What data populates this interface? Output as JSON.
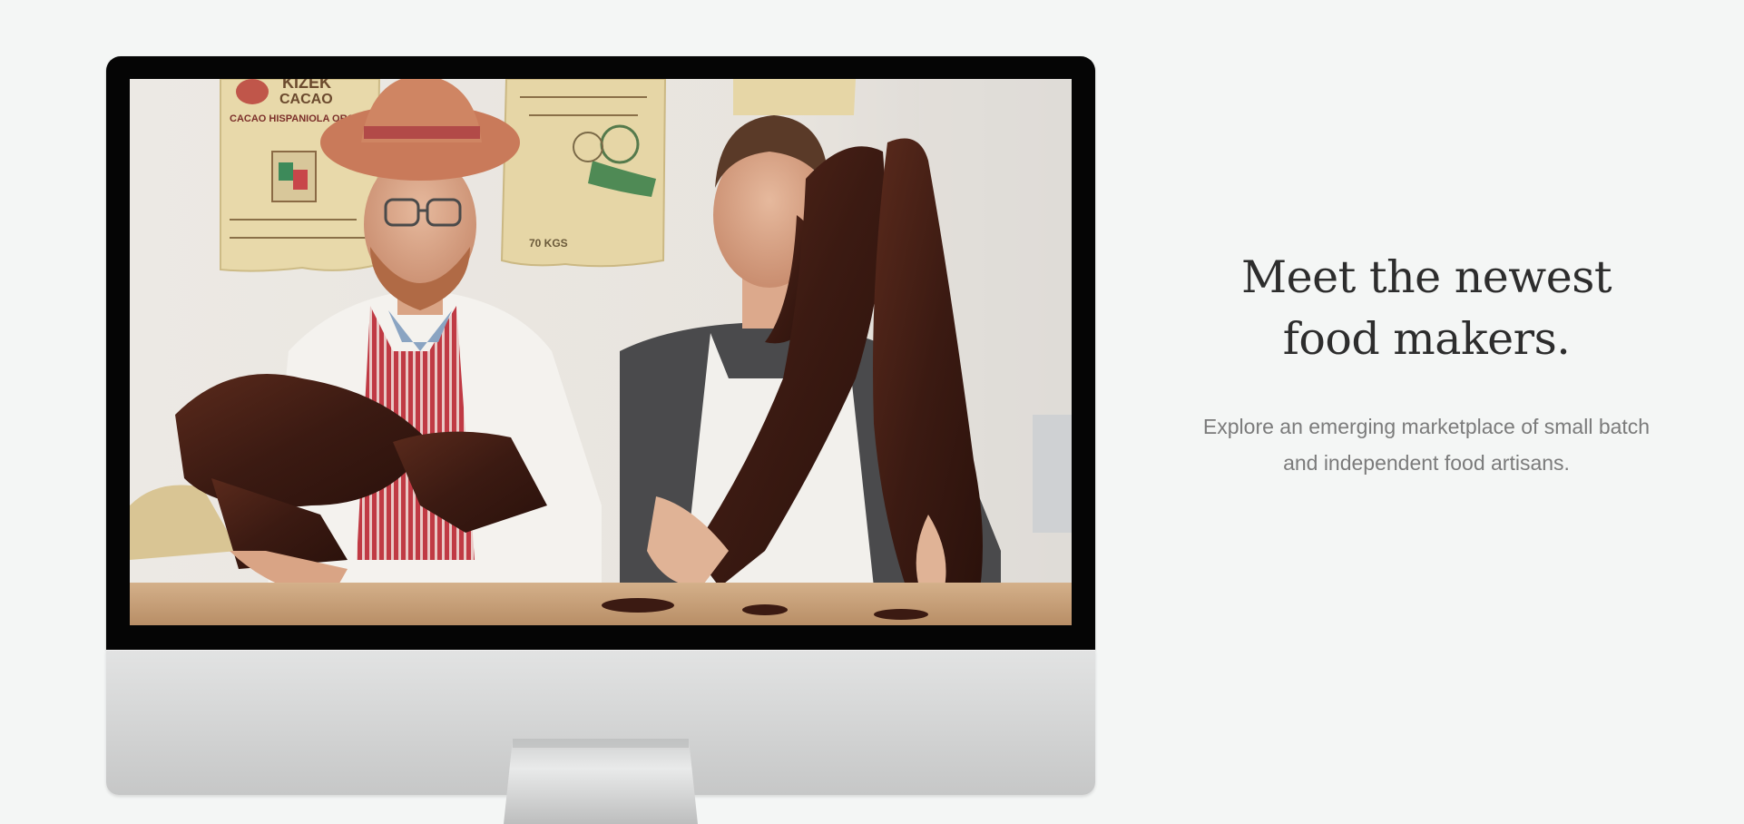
{
  "hero": {
    "headline_line1": "Meet the newest",
    "headline_line2": "food makers.",
    "subcopy": "Explore an emerging marketplace of small batch and independent food artisans."
  },
  "screen_photo": {
    "sack_labels": [
      "KIZEK",
      "CACAO",
      "CACAO HISPANIOLA ORGANICO",
      "70 KGS"
    ],
    "colors": {
      "wall": "#ebe7e2",
      "sack": "#e6d6a6",
      "chocolate": "#3b1a12",
      "apron_stripe": "#b8323e",
      "table": "#c9a27a"
    }
  },
  "colors": {
    "background": "#f4f6f5",
    "headline": "#2d2d2d",
    "subcopy": "#7b7b7b",
    "bezel": "#050505",
    "aluminum": "#d7d8d8"
  }
}
